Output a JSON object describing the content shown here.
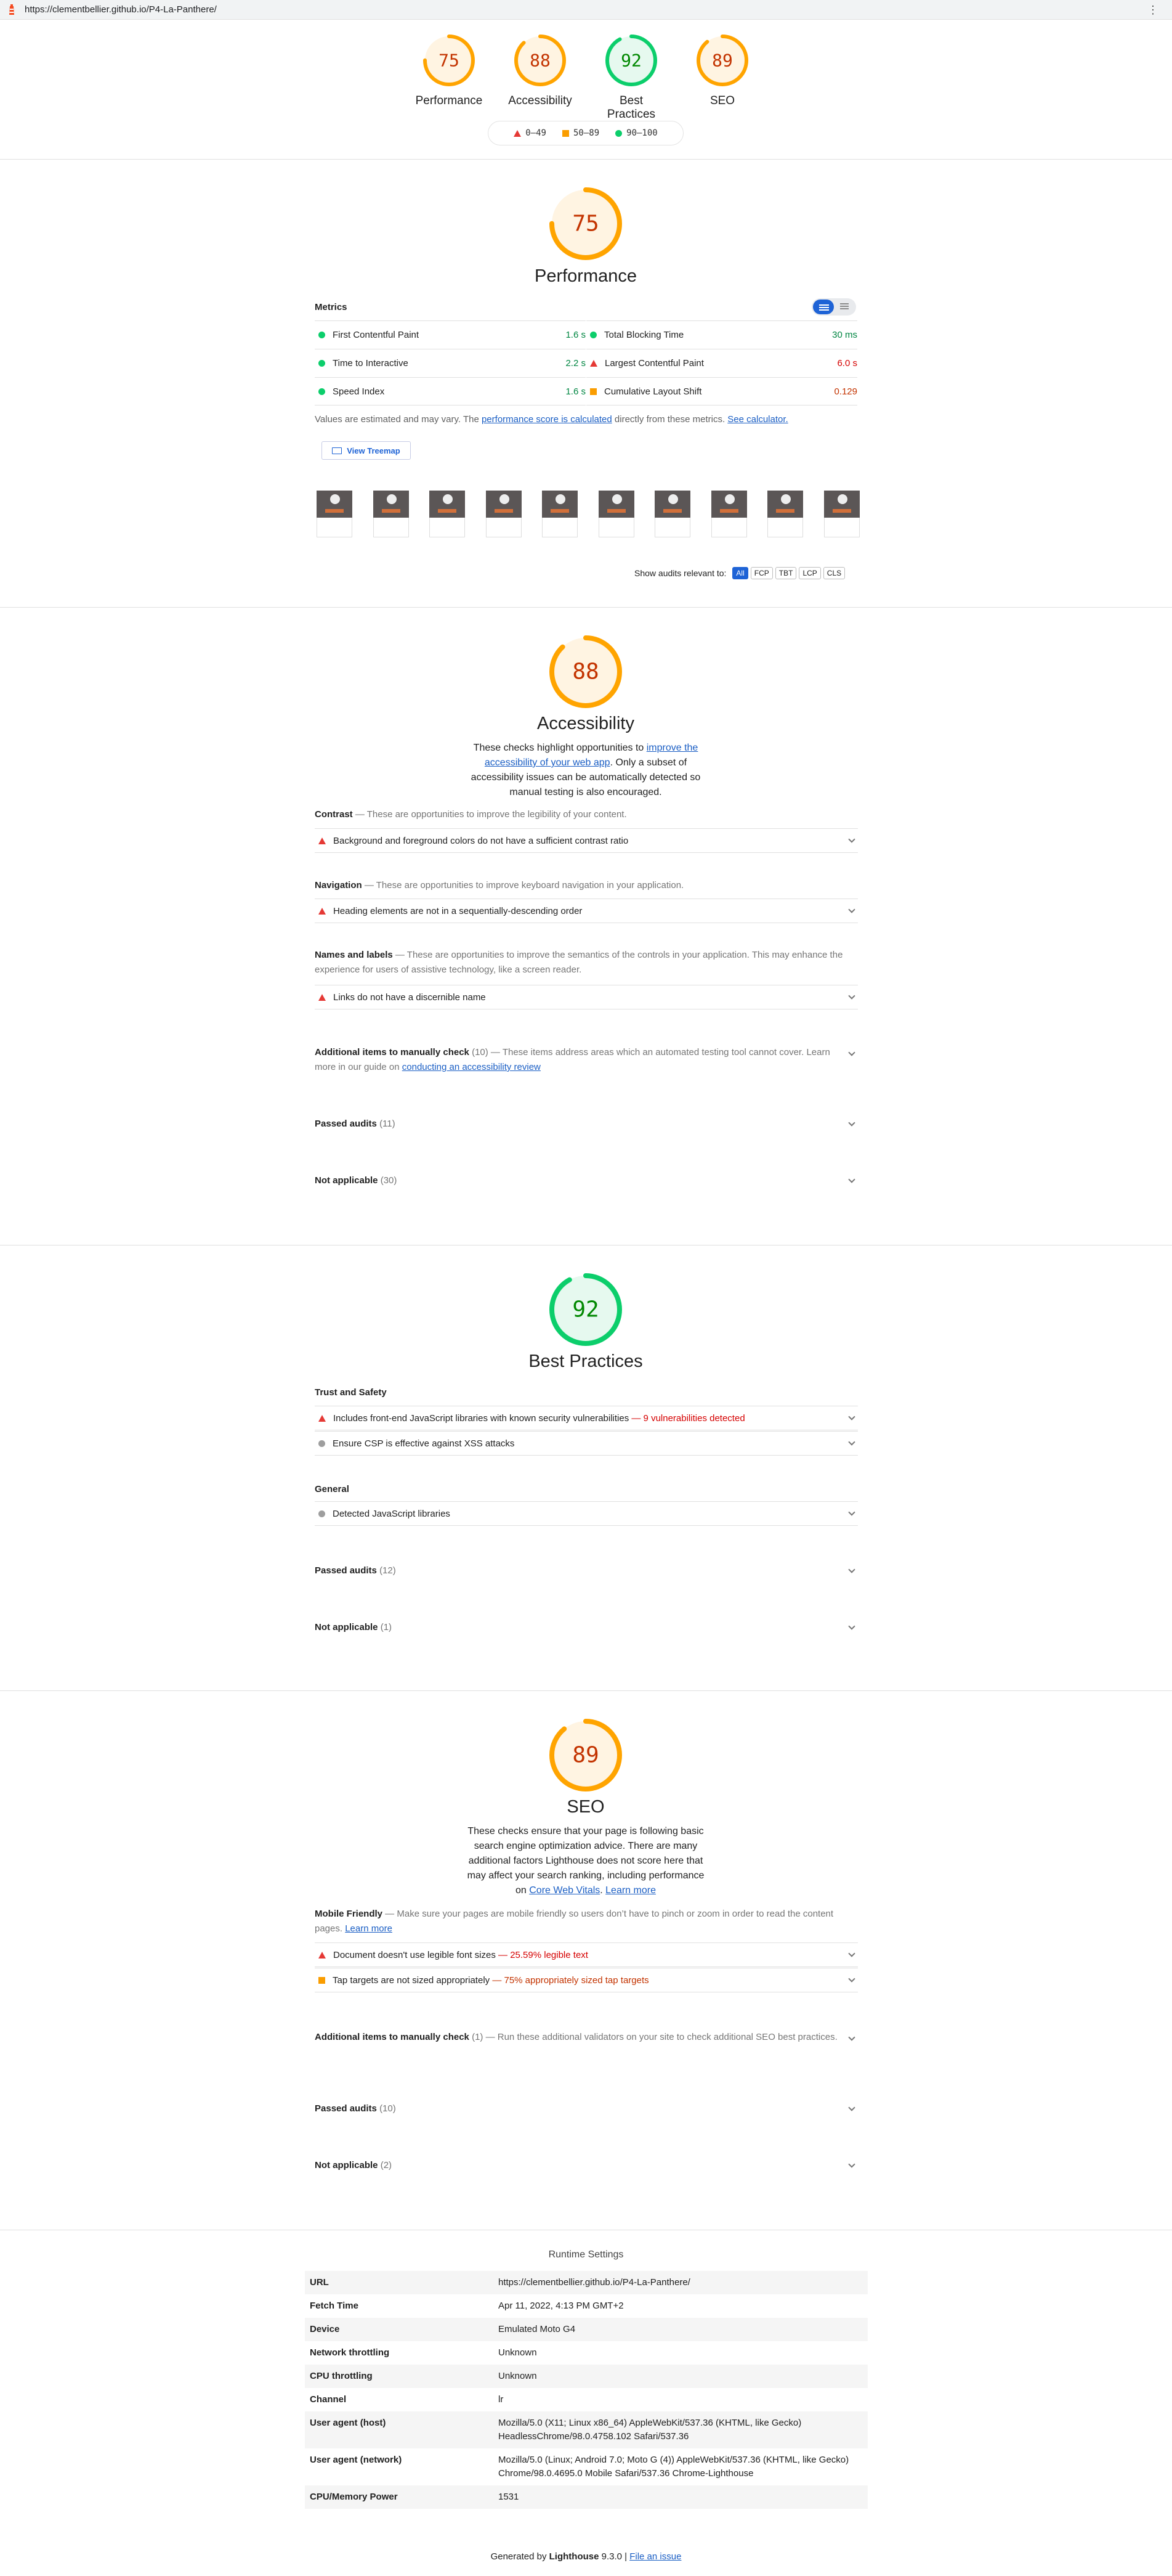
{
  "topbar": {
    "url": "https://clementbellier.github.io/P4-La-Panthere/",
    "menu_icon": "⋮"
  },
  "colors": {
    "pass": "#0cce6b",
    "average": "#ffa400",
    "fail": "#ff4e42",
    "link": "#1a5ec4"
  },
  "summary": [
    {
      "score": 75,
      "label": "Performance",
      "rating": "average"
    },
    {
      "score": 88,
      "label": "Accessibility",
      "rating": "average"
    },
    {
      "score": 92,
      "label": "Best Practices",
      "rating": "pass"
    },
    {
      "score": 89,
      "label": "SEO",
      "rating": "average"
    }
  ],
  "legend": {
    "fail": "0–49",
    "average": "50–89",
    "pass": "90–100"
  },
  "performance": {
    "score": 75,
    "title": "Performance",
    "metrics_label": "Metrics",
    "metrics": [
      {
        "name": "First Contentful Paint",
        "value": "1.6 s",
        "status": "pass"
      },
      {
        "name": "Total Blocking Time",
        "value": "30 ms",
        "status": "pass"
      },
      {
        "name": "Time to Interactive",
        "value": "2.2 s",
        "status": "pass"
      },
      {
        "name": "Largest Contentful Paint",
        "value": "6.0 s",
        "status": "fail"
      },
      {
        "name": "Speed Index",
        "value": "1.6 s",
        "status": "pass"
      },
      {
        "name": "Cumulative Layout Shift",
        "value": "0.129",
        "status": "average"
      }
    ],
    "note_prefix": "Values are estimated and may vary. The ",
    "note_link1": "performance score is calculated",
    "note_mid": " directly from these metrics. ",
    "note_link2": "See calculator.",
    "treemap_label": "View Treemap",
    "thumbnail_count": 10,
    "relevant_label": "Show audits relevant to:",
    "filters": [
      "All",
      "FCP",
      "TBT",
      "LCP",
      "CLS"
    ]
  },
  "accessibility": {
    "score": 88,
    "title": "Accessibility",
    "desc_1": "These checks highlight opportunities to ",
    "desc_link": "improve the accessibility of your web app",
    "desc_2": ". Only a subset of accessibility issues can be automatically detected so manual testing is also encouraged.",
    "groups": [
      {
        "title": "Contrast",
        "desc": " — These are opportunities to improve the legibility of your content.",
        "audit": "Background and foreground colors do not have a sufficient contrast ratio"
      },
      {
        "title": "Navigation",
        "desc": " — These are opportunities to improve keyboard navigation in your application.",
        "audit": "Heading elements are not in a sequentially-descending order"
      },
      {
        "title": "Names and labels",
        "desc": " — These are opportunities to improve the semantics of the controls in your application. This may enhance the experience for users of assistive technology, like a screen reader.",
        "audit": "Links do not have a discernible name"
      }
    ],
    "manual_title": "Additional items to manually check",
    "manual_count": "(10)",
    "manual_desc": " — These items address areas which an automated testing tool cannot cover. Learn more in our guide on ",
    "manual_link": "conducting an accessibility review",
    "passed_title": "Passed audits",
    "passed_count": "(11)",
    "na_title": "Not applicable",
    "na_count": "(30)"
  },
  "best_practices": {
    "score": 92,
    "title": "Best Practices",
    "group1": "Trust and Safety",
    "audit1": "Includes front-end JavaScript libraries with known security vulnerabilities",
    "audit1_detail": " — 9 vulnerabilities detected",
    "audit2": "Ensure CSP is effective against XSS attacks",
    "group2": "General",
    "audit3": "Detected JavaScript libraries",
    "passed_title": "Passed audits",
    "passed_count": "(12)",
    "na_title": "Not applicable",
    "na_count": "(1)"
  },
  "seo": {
    "score": 89,
    "title": "SEO",
    "desc_1": "These checks ensure that your page is following basic search engine optimization advice. There are many additional factors Lighthouse does not score here that may affect your search ranking, including performance on ",
    "desc_link1": "Core Web Vitals",
    "desc_2": ". ",
    "desc_link2": "Learn more",
    "group_title": "Mobile Friendly",
    "group_desc": " — Make sure your pages are mobile friendly so users don’t have to pinch or zoom in order to read the content pages. ",
    "group_link": "Learn more",
    "audit1": "Document doesn't use legible font sizes",
    "audit1_detail": " — 25.59% legible text",
    "audit2": "Tap targets are not sized appropriately",
    "audit2_detail": " — 75% appropriately sized tap targets",
    "manual_title": "Additional items to manually check",
    "manual_count": "(1)",
    "manual_desc": " — Run these additional validators on your site to check additional SEO best practices.",
    "passed_title": "Passed audits",
    "passed_count": "(10)",
    "na_title": "Not applicable",
    "na_count": "(2)"
  },
  "runtime": {
    "title": "Runtime Settings",
    "rows": [
      {
        "k": "URL",
        "v": "https://clementbellier.github.io/P4-La-Panthere/"
      },
      {
        "k": "Fetch Time",
        "v": "Apr 11, 2022, 4:13 PM GMT+2"
      },
      {
        "k": "Device",
        "v": "Emulated Moto G4"
      },
      {
        "k": "Network throttling",
        "v": "Unknown"
      },
      {
        "k": "CPU throttling",
        "v": "Unknown"
      },
      {
        "k": "Channel",
        "v": "lr"
      },
      {
        "k": "User agent (host)",
        "v": "Mozilla/5.0 (X11; Linux x86_64) AppleWebKit/537.36 (KHTML, like Gecko) HeadlessChrome/98.0.4758.102 Safari/537.36"
      },
      {
        "k": "User agent (network)",
        "v": "Mozilla/5.0 (Linux; Android 7.0; Moto G (4)) AppleWebKit/537.36 (KHTML, like Gecko) Chrome/98.0.4695.0 Mobile Safari/537.36 Chrome-Lighthouse"
      },
      {
        "k": "CPU/Memory Power",
        "v": "1531"
      }
    ]
  },
  "footer": {
    "prefix": "Generated by ",
    "brand": "Lighthouse",
    "version": " 9.3.0 | ",
    "issue_link": "File an issue"
  }
}
